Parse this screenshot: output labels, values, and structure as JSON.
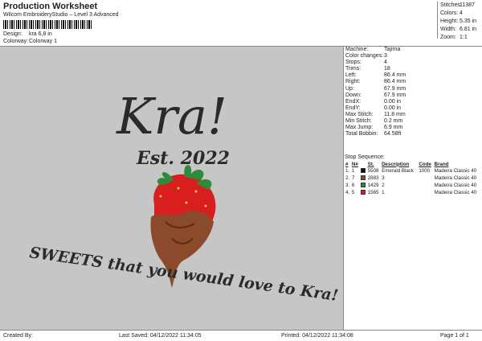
{
  "header": {
    "title": "Production Worksheet",
    "subtitle": "Wilcom EmbroideryStudio – Level 3 Advanced",
    "design_label": "Design:",
    "design_value": "kra 6,8 in",
    "colorway_label": "Colorway:",
    "colorway_value": "Colorway 1"
  },
  "stats": [
    {
      "label": "Stitches:",
      "value": "11387"
    },
    {
      "label": "Colors:",
      "value": "4"
    },
    {
      "label": "Height:",
      "value": "5.35 in"
    },
    {
      "label": "Width:",
      "value": "6.81 in"
    },
    {
      "label": "Zoom:",
      "value": "1:1"
    }
  ],
  "design": {
    "title_text": "Kra!",
    "est_text": "Est. 2022",
    "slogan": "SWEETS that you would love to Kra!"
  },
  "info": [
    {
      "label": "Machine:",
      "value": "Tajima"
    },
    {
      "label": "Color changes:",
      "value": "3"
    },
    {
      "label": "Stops:",
      "value": "4"
    },
    {
      "label": "Trims:",
      "value": "18"
    },
    {
      "label": "Left:",
      "value": "86.4 mm"
    },
    {
      "label": "Right:",
      "value": "86.4 mm"
    },
    {
      "label": "Up:",
      "value": "67.9 mm"
    },
    {
      "label": "Down:",
      "value": "67.9 mm"
    },
    {
      "label": "EndX:",
      "value": "0.00 in"
    },
    {
      "label": "EndY:",
      "value": "0.00 in"
    },
    {
      "label": "Max Stitch:",
      "value": "11.8 mm"
    },
    {
      "label": "Min Stitch:",
      "value": "0.2 mm"
    },
    {
      "label": "Max Jump:",
      "value": "6.9 mm"
    },
    {
      "label": "Total Bobbin:",
      "value": "64.58ft"
    }
  ],
  "sequence": {
    "title": "Stop Sequence:",
    "columns": [
      "#",
      "N#",
      "",
      "St.",
      "Description",
      "Code",
      "Brand"
    ],
    "rows": [
      {
        "num": "1.",
        "n": "1",
        "color": "#111111",
        "st": "5508",
        "desc": "Emerald Black",
        "code": "1000",
        "brand": "Madeira Classic 40"
      },
      {
        "num": "2.",
        "n": "7",
        "color": "#8b4a2b",
        "st": "2883",
        "desc": "3",
        "code": "",
        "brand": "Madeira Classic 40"
      },
      {
        "num": "3.",
        "n": "6",
        "color": "#2e8b3a",
        "st": "1429",
        "desc": "2",
        "code": "",
        "brand": "Madeira Classic 40"
      },
      {
        "num": "4.",
        "n": "5",
        "color": "#d81e1e",
        "st": "1565",
        "desc": "1",
        "code": "",
        "brand": "Madeira Classic 40"
      }
    ]
  },
  "footer": {
    "created": "Created By:",
    "saved": "Last Saved: 04/12/2022 11:34:05",
    "printed": "Printed: 04/12/2022 11:34:08",
    "page": "Page 1 of 1"
  }
}
